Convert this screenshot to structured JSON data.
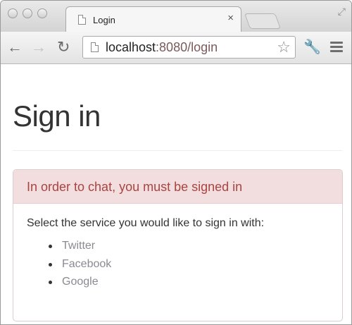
{
  "browser": {
    "tab_title": "Login",
    "tab_close": "×",
    "url_host": "localhost",
    "url_rest": ":8080/login",
    "icons": {
      "back": "back-arrow-icon",
      "forward": "forward-arrow-icon",
      "reload": "reload-icon",
      "star": "star-icon",
      "wrench": "wrench-icon",
      "menu": "menu-icon"
    }
  },
  "page": {
    "title": "Sign in",
    "alert": "In order to chat, you must be signed in",
    "prompt": "Select the service you would like to sign in with:",
    "services": [
      "Twitter",
      "Facebook",
      "Google"
    ],
    "colors": {
      "alert_bg": "#f2dede",
      "alert_text": "#a94442",
      "link": "#8a8a93"
    }
  }
}
